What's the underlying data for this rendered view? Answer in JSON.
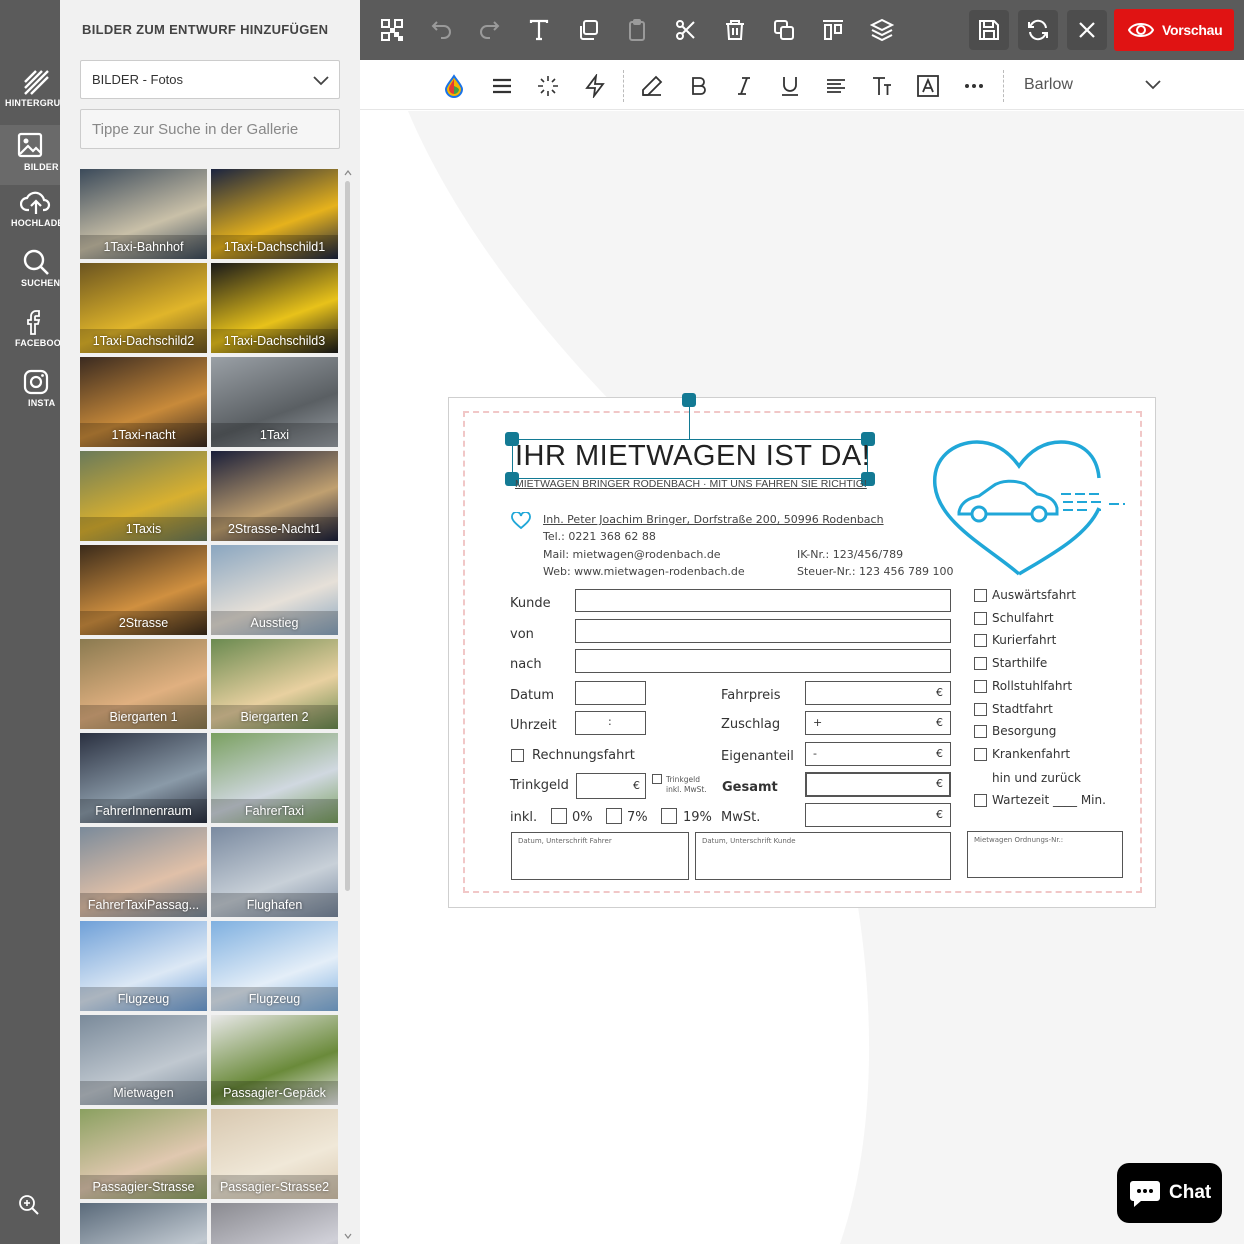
{
  "rail": {
    "items": [
      {
        "label": "HINTERGRUND",
        "icon": "background-icon"
      },
      {
        "label": "BILDER",
        "icon": "image-icon"
      },
      {
        "label": "HOCHLADEN",
        "icon": "upload-cloud-icon"
      },
      {
        "label": "SUCHEN",
        "icon": "search-icon"
      },
      {
        "label": "FACEBOOK",
        "icon": "facebook-icon"
      },
      {
        "label": "INSTA",
        "icon": "instagram-icon"
      }
    ],
    "zoom_icon": "zoom-in-icon"
  },
  "panel": {
    "title": "BILDER ZUM ENTWURF HINZUFÜGEN",
    "category_select": "BILDER - Fotos",
    "search_placeholder": "Tippe zur Suche in der Gallerie",
    "images": [
      "1Taxi-Bahnhof",
      "1Taxi-Dachschild1",
      "1Taxi-Dachschild2",
      "1Taxi-Dachschild3",
      "1Taxi-nacht",
      "1Taxi",
      "1Taxis",
      "2Strasse-Nacht1",
      "2Strasse",
      "Ausstieg",
      "Biergarten 1",
      "Biergarten 2",
      "FahrerInnenraum",
      "FahrerTaxi",
      "FahrerTaxiPassag...",
      "Flughafen",
      "Flugzeug",
      "Flugzeug",
      "Mietwagen",
      "Passagier-Gepäck",
      "Passagier-Strasse",
      "Passagier-Strasse2",
      "",
      ""
    ]
  },
  "toolbar": {
    "icons": [
      "qr-code-icon",
      "undo-icon",
      "redo-icon",
      "text-icon",
      "copy-style-icon",
      "paste-icon",
      "cut-icon",
      "delete-icon",
      "duplicate-icon",
      "align-top-icon",
      "layers-icon"
    ],
    "right_icons": [
      "save-icon",
      "refresh-icon",
      "close-icon"
    ],
    "preview_label": "Vorschau"
  },
  "format_bar": {
    "icons": [
      "color-drop-icon",
      "line-spacing-icon",
      "effects-icon",
      "flash-icon",
      "pen-icon",
      "bold-icon",
      "italic-icon",
      "underline-icon",
      "align-icon",
      "text-size-icon",
      "text-frame-icon",
      "more-icon"
    ],
    "font": "Barlow"
  },
  "card": {
    "headline": "IHR MIETWAGEN IST DA!",
    "subline_a": "MIETWAGEN BRINGER RODENBACH · ",
    "subline_b": "MIT UNS FAHREN SIE RICHTIG!",
    "address": "Inh. Peter Joachim Bringer, Dorfstraße 200, 50996 Rodenbach",
    "tel": "Tel.: 0221 368 62 88",
    "mail": "Mail: mietwagen@rodenbach.de",
    "web": "Web: www.mietwagen-rodenbach.de",
    "ik": "IK-Nr.: 123/456/789",
    "steuer": "Steuer-Nr.: 123 456 789 100",
    "labels": {
      "kunde": "Kunde",
      "von": "von",
      "nach": "nach",
      "datum": "Datum",
      "uhrzeit": "Uhrzeit",
      "uhrzeit_sep": ":",
      "rechnungsfahrt": "Rechnungsfahrt",
      "trinkgeld": "Trinkgeld",
      "trinkgeld_note_1": "Trinkgeld",
      "trinkgeld_note_2": "inkl. MwSt.",
      "inkl": "inkl.",
      "p0": "0%",
      "p7": "7%",
      "p19": "19%",
      "fahrpreis": "Fahrpreis",
      "zuschlag": "Zuschlag",
      "eigenanteil": "Eigenanteil",
      "gesamt": "Gesamt",
      "mwst": "MwSt.",
      "currency": "€",
      "plus": "+",
      "minus": "-"
    },
    "options": [
      "Auswärtsfahrt",
      "Schulfahrt",
      "Kurierfahrt",
      "Starthilfe",
      "Rollstuhlfahrt",
      "Stadtfahrt",
      "Besorgung",
      "Krankenfahrt"
    ],
    "option_hin": "hin und zurück",
    "option_wartezeit": "Wartezeit ____ Min.",
    "sig_fahrer": "Datum, Unterschrift Fahrer",
    "sig_kunde": "Datum, Unterschrift Kunde",
    "ordnung": "Mietwagen Ordnungs-Nr.:"
  },
  "chat": {
    "label": "Chat"
  }
}
